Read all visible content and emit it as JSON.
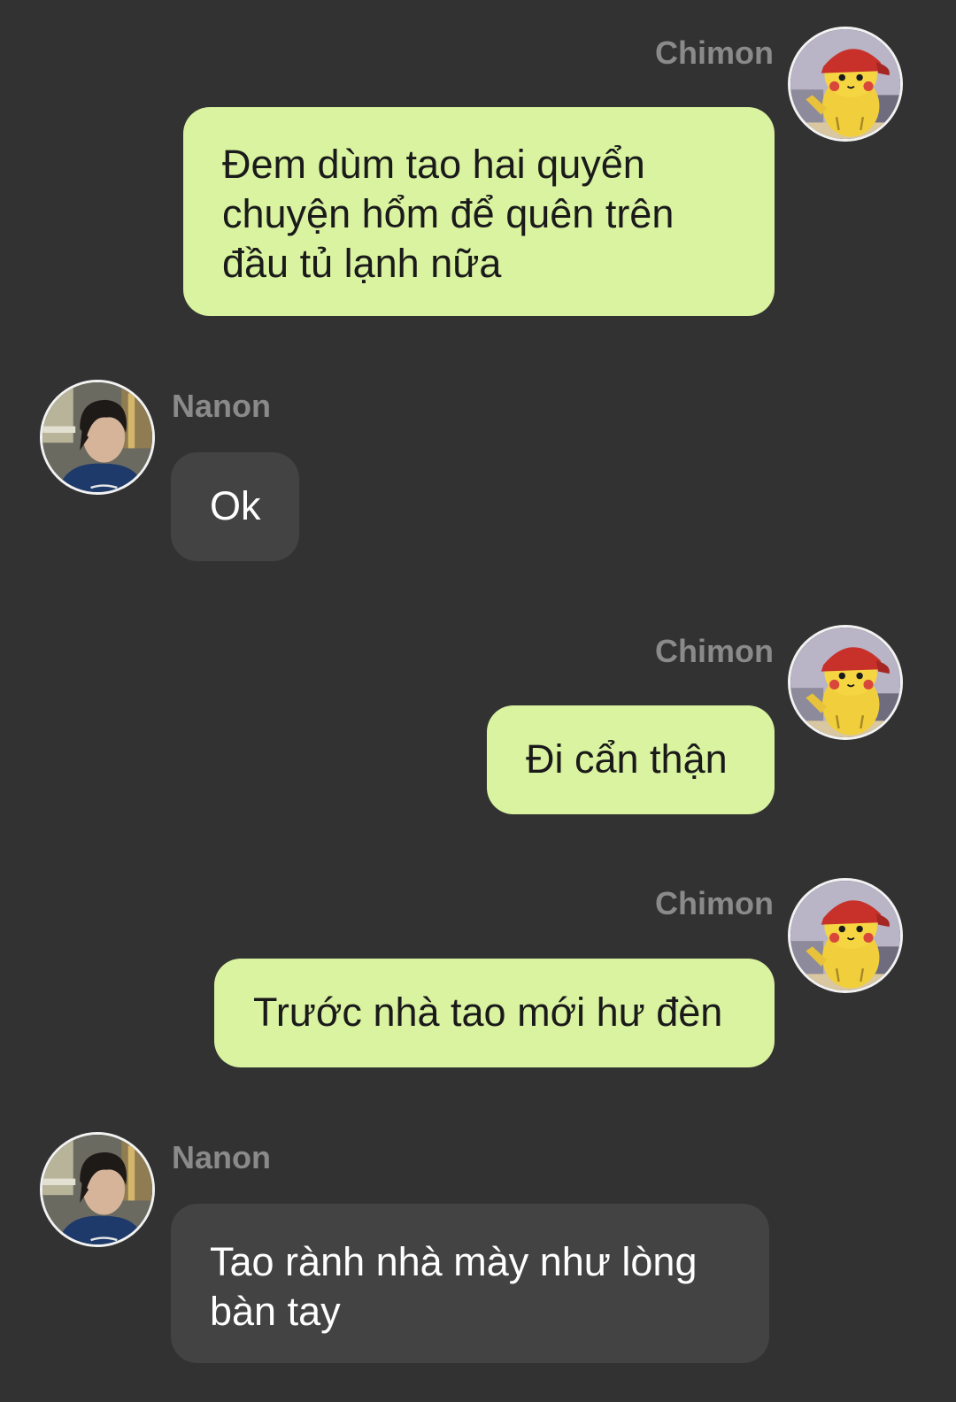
{
  "messages": [
    {
      "sender": "Chimon",
      "text": "Đem dùm tao hai quyển chuyện hổm để quên trên đầu tủ lạnh nữa",
      "avatar_icon": "pikachu-avatar-icon"
    },
    {
      "sender": "Nanon",
      "text": "Ok",
      "avatar_icon": "person-avatar-icon"
    },
    {
      "sender": "Chimon",
      "text": "Đi cẩn thận",
      "avatar_icon": "pikachu-avatar-icon"
    },
    {
      "sender": "Chimon",
      "text": "Trước nhà tao mới hư đèn",
      "avatar_icon": "pikachu-avatar-icon"
    },
    {
      "sender": "Nanon",
      "text": "Tao rành nhà mày như lòng bàn tay",
      "avatar_icon": "person-avatar-icon"
    }
  ],
  "colors": {
    "background": "#323232",
    "outgoing_bubble": "#d9f3a0",
    "incoming_bubble": "#434343",
    "sender_name": "#8a8a8a"
  }
}
